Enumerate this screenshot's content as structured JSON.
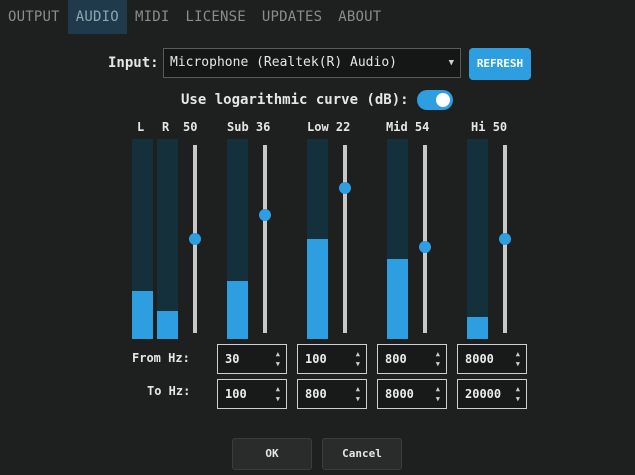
{
  "tabs": [
    "OUTPUT",
    "AUDIO",
    "MIDI",
    "LICENSE",
    "UPDATES",
    "ABOUT"
  ],
  "input": {
    "label": "Input:",
    "selected": "Microphone (Realtek(R) Audio)",
    "refresh_label": "REFRESH"
  },
  "log_curve": {
    "label": "Use logarithmic curve (dB):",
    "enabled": true
  },
  "master": {
    "left_label": "L",
    "right_label": "R",
    "value": "50",
    "left_level": 0.24,
    "right_level": 0.14,
    "slider": 0.5
  },
  "bands": [
    {
      "name": "Sub",
      "value": "36",
      "level": 0.29,
      "slider": 0.37,
      "from": "30",
      "to": "100"
    },
    {
      "name": "Low",
      "value": "22",
      "level": 0.5,
      "slider": 0.23,
      "from": "100",
      "to": "800"
    },
    {
      "name": "Mid",
      "value": "54",
      "level": 0.4,
      "slider": 0.54,
      "from": "800",
      "to": "8000"
    },
    {
      "name": "Hi",
      "value": "50",
      "level": 0.11,
      "slider": 0.5,
      "from": "8000",
      "to": "20000"
    }
  ],
  "from_hz_label": "From Hz:",
  "to_hz_label": "To Hz:",
  "ok_label": "OK",
  "cancel_label": "Cancel",
  "colors": {
    "accent": "#2d9ee0",
    "meter_bg": "#14313b",
    "background": "#1e1f1f"
  }
}
